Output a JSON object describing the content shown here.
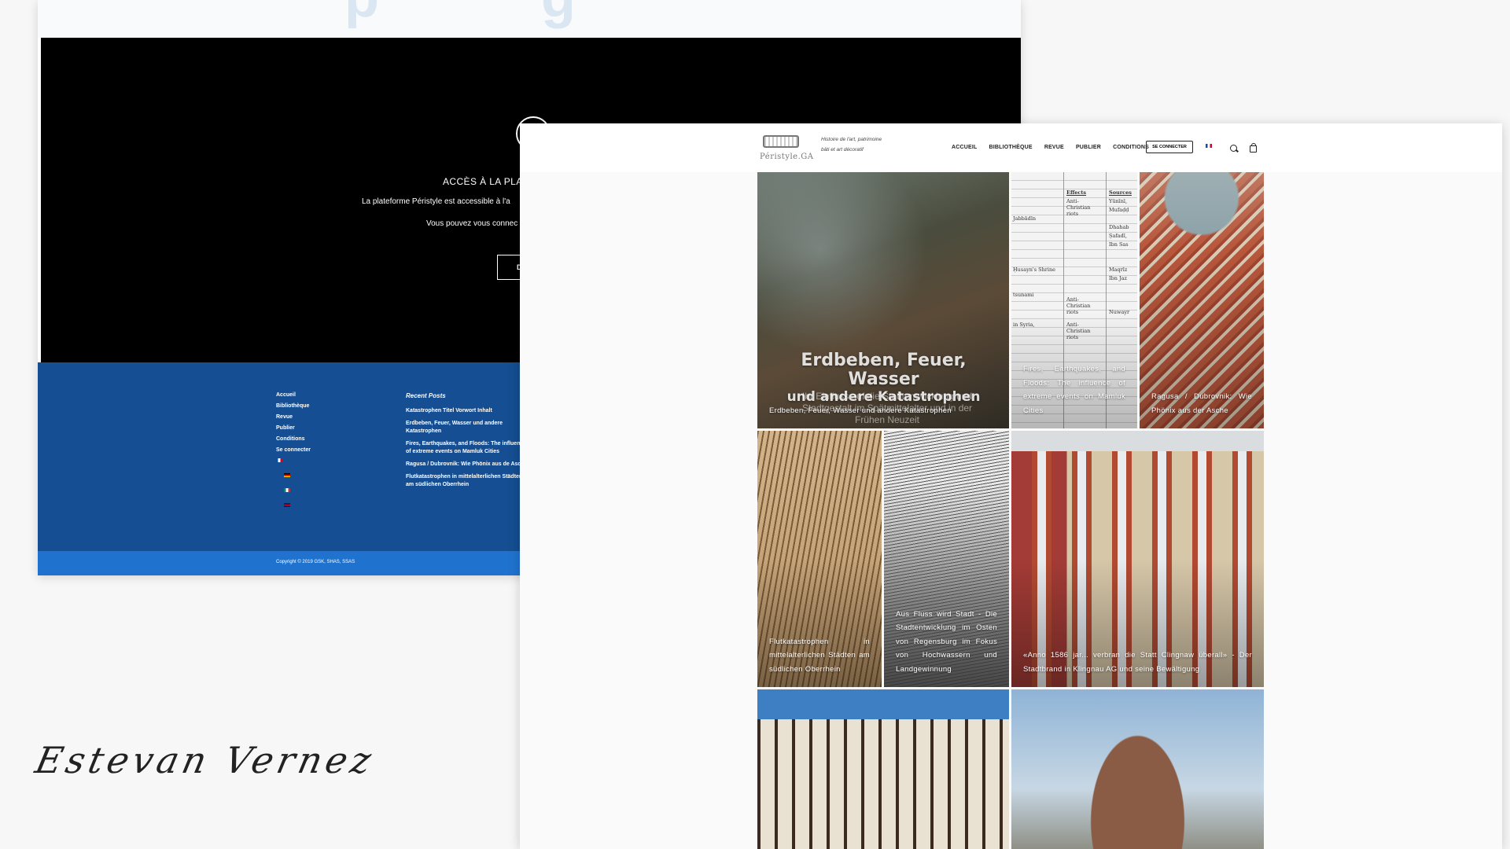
{
  "back_window": {
    "access_title": "ACCÈS À LA PLAT",
    "access_p1": "La plateforme Péristyle est accessible à l'a",
    "access_p2": "Vous pouvez vous connec",
    "button_label": "D",
    "footer_menu": [
      "Accueil",
      "Bibliothèque",
      "Revue",
      "Publier",
      "Conditions",
      "Se connecter"
    ],
    "recent_title": "Recent Posts",
    "recent_posts": [
      "Katastrophen Titel Vorwort Inhalt",
      "Erdbeben, Feuer, Wasser und andere Katastrophen",
      "Fires, Earthquakes, and Floods: The influence of extreme events on Mamluk Cities",
      "Ragusa / Dubrovnik: Wie Phönix aus de Asche",
      "Flutkatastrophen in mittelalterlichen Städten am südlichen Oberrhein"
    ],
    "copyright": "Copyright © 2019 GSK, SHAS, SSAS"
  },
  "signature": "Estevan Vernez",
  "front_window": {
    "logo_text": "Péristyle.GA",
    "tagline": "Histoire de l'art, patrimoine bâti et art décoratif",
    "nav": [
      "ACCUEIL",
      "BIBLIOTHÈQUE",
      "REVUE",
      "PUBLIER",
      "CONDITIONS"
    ],
    "login_label": "SE CONNECTER",
    "tiles": {
      "t1": {
        "caption": "Erdbeben, Feuer, Wasser und andere Katastrophen",
        "art_title": "Erdbeben, Feuer, Wasser",
        "art_title_2": "und andere Katastrophen",
        "art_sub": "Ihr Einfluss auf die Stadtentwicklung und Stadtgestalt im Spätmittelalter und in der Frühen Neuzeit"
      },
      "t2": {
        "caption": "Fires, Earthquakes, and Floods: The influence of extreme events on Mamluk Cities",
        "table": {
          "col_effects": "Effects",
          "col_sources": "Sources",
          "riots_1": "Anti-Christian riots",
          "riots_2": "Anti-Christian riots",
          "riots_3": "Anti-Christian riots",
          "row_1": "Jabbādīn",
          "row_2": "Ḥusayn's Shrine",
          "row_3": "tsunami",
          "row_4": "in Syria,",
          "src_1": "Yūnīnī,",
          "src_2": "Mufaḍḍ",
          "src_3": "Dhahab",
          "src_4": "Ṣafadī,",
          "src_5": "Ibn Sas",
          "src_6": "Maqrīz",
          "src_7": "Ibn Jaz",
          "src_8": "Nuwayr"
        }
      },
      "t3": {
        "caption": "Ragusa / Dubrovnik: Wie Phönix aus der Asche"
      },
      "t4": {
        "caption": "Flutkatastrophen in mittelalterlichen Städten am südlichen Oberrhein"
      },
      "t5": {
        "caption": "Aus Fluss wird Stadt - Die Stadtentwicklung im Osten von Regensburg im Fokus von Hochwassern und Landgewinnung"
      },
      "t6": {
        "caption": "«Anno 1586 jar... verbran die Statt Clingnaw überall» - Der Stadtbrand in Klingnau AG und seine Bewältigung"
      }
    }
  }
}
